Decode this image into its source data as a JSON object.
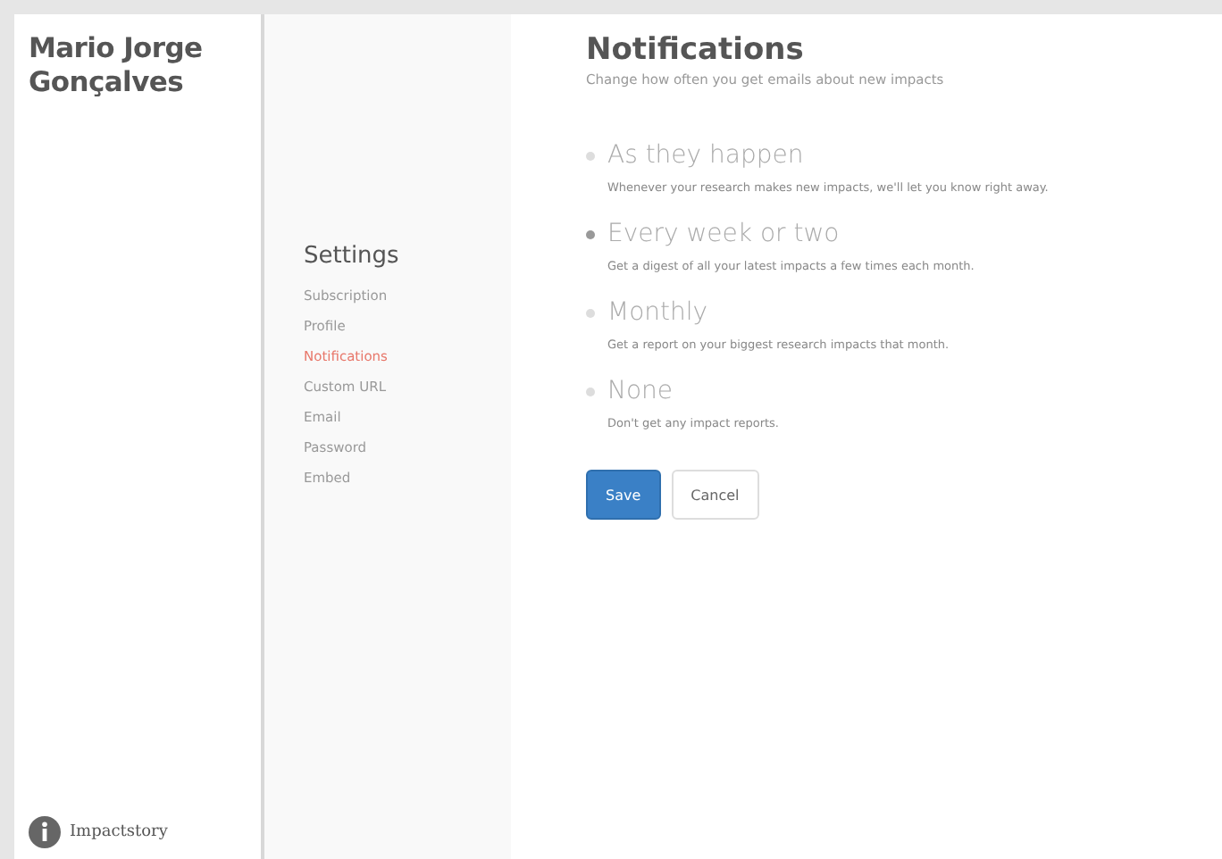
{
  "user": {
    "name": "Mario Jorge Gonçalves"
  },
  "logo": {
    "text": "Impactstory"
  },
  "settings_nav": {
    "title": "Settings",
    "items": [
      {
        "label": "Subscription",
        "selected": false
      },
      {
        "label": "Profile",
        "selected": false
      },
      {
        "label": "Notifications",
        "selected": true
      },
      {
        "label": "Custom URL",
        "selected": false
      },
      {
        "label": "Email",
        "selected": false
      },
      {
        "label": "Password",
        "selected": false
      },
      {
        "label": "Embed",
        "selected": false
      }
    ]
  },
  "notifications": {
    "title": "Notifications",
    "subtitle": "Change how often you get emails about new impacts",
    "options": [
      {
        "label": "As they happen",
        "description": "Whenever your research makes new impacts, we'll let you know right away.",
        "selected": false
      },
      {
        "label": "Every week or two",
        "description": "Get a digest of all your latest impacts a few times each month.",
        "selected": true
      },
      {
        "label": "Monthly",
        "description": "Get a report on your biggest research impacts that month.",
        "selected": false
      },
      {
        "label": "None",
        "description": "Don't get any impact reports.",
        "selected": false
      }
    ]
  },
  "buttons": {
    "save": "Save",
    "cancel": "Cancel"
  }
}
